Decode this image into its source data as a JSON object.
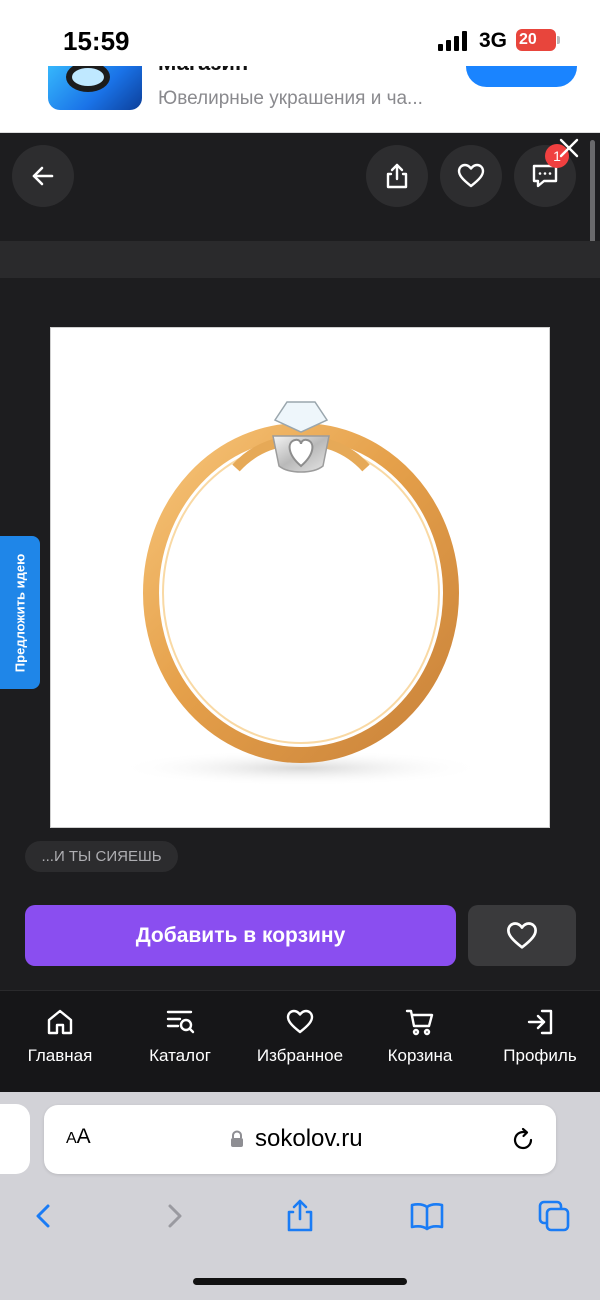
{
  "status_bar": {
    "time": "15:59",
    "network": "3G",
    "battery": "20"
  },
  "app_banner": {
    "name": "Магазин",
    "subtitle": "Ювелирные украшения и ча..."
  },
  "header": {
    "notification_count": "1"
  },
  "side_tab": {
    "label": "Предложить идею"
  },
  "product": {
    "tag": "...И ТЫ СИЯЕШЬ",
    "add_to_cart_label": "Добавить в корзину"
  },
  "bottom_nav": {
    "items": [
      {
        "label": "Главная",
        "icon": "home-icon"
      },
      {
        "label": "Каталог",
        "icon": "catalog-icon"
      },
      {
        "label": "Избранное",
        "icon": "heart-icon"
      },
      {
        "label": "Корзина",
        "icon": "cart-icon"
      },
      {
        "label": "Профиль",
        "icon": "login-icon"
      }
    ]
  },
  "browser": {
    "text_size_label": "AA",
    "url": "sokolov.ru"
  },
  "colors": {
    "accent": "#8a4ef0",
    "side_tab": "#1f86e8",
    "badge": "#f04040",
    "background": "#1d1d1f"
  }
}
